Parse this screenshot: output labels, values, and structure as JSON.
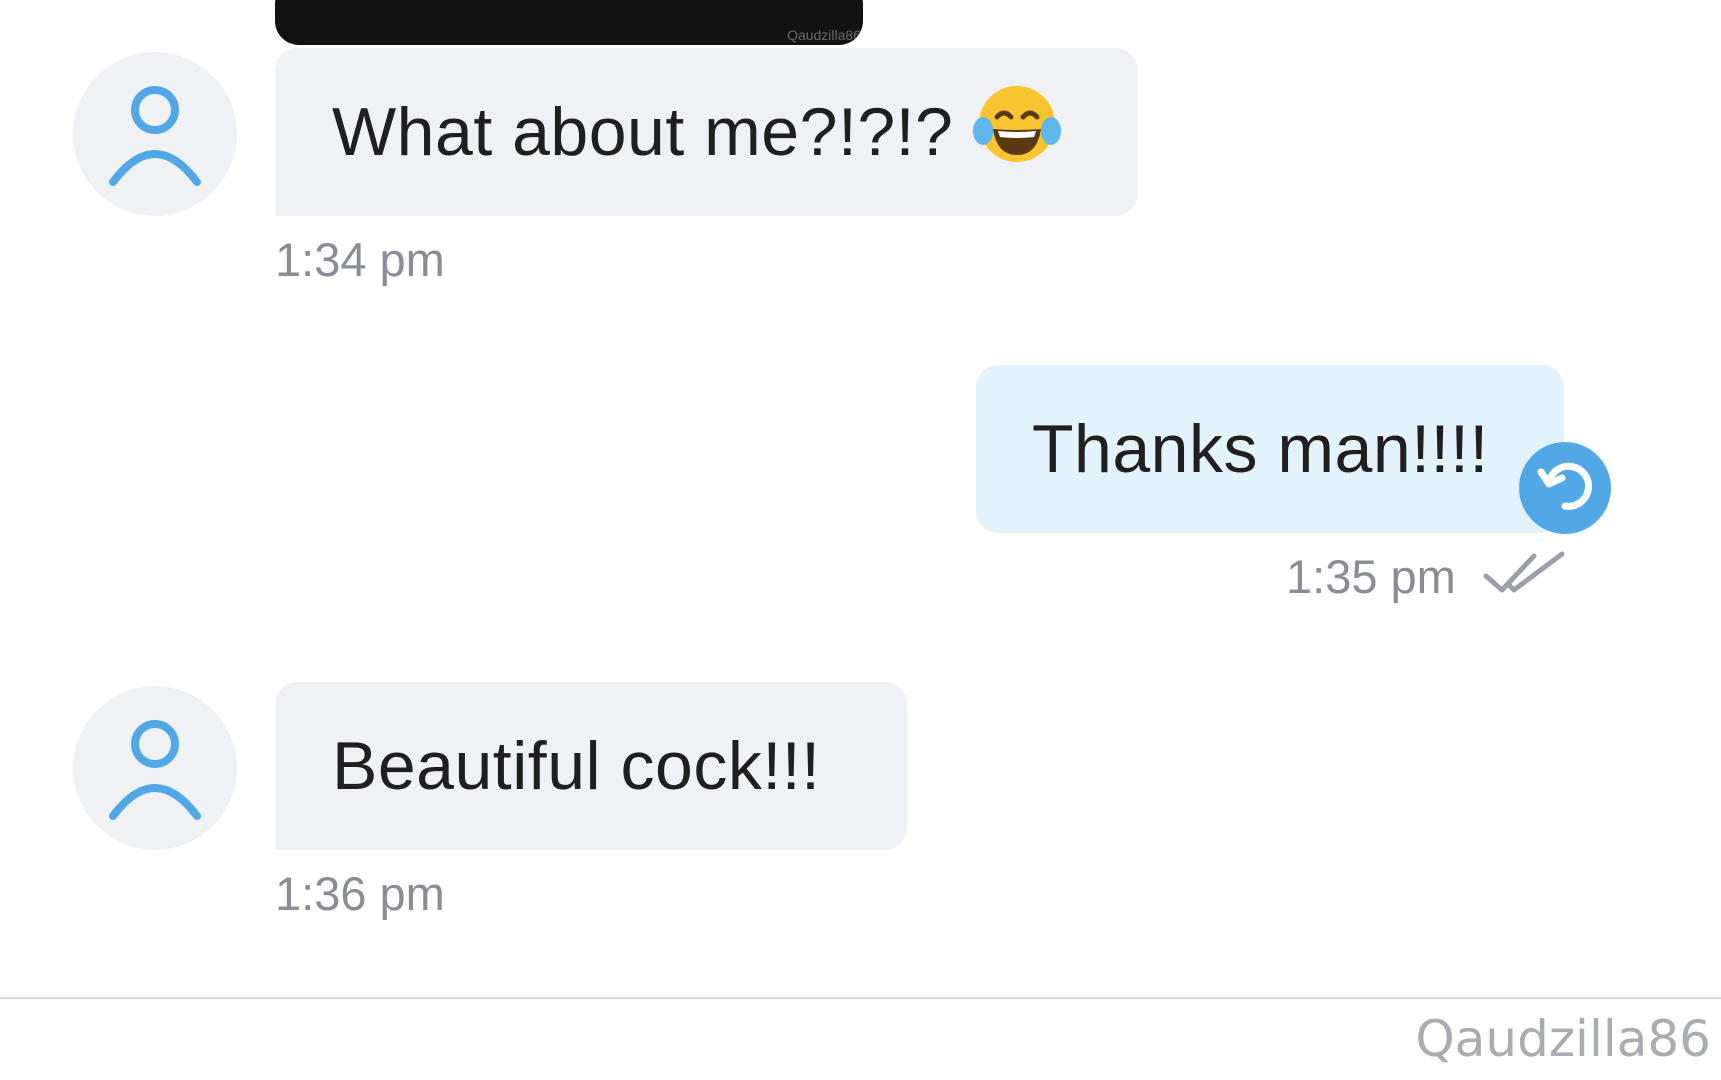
{
  "media": {
    "watermark": "Qaudzilla86"
  },
  "messages": [
    {
      "direction": "incoming",
      "text": "What about me?!?!?",
      "emoji": "😂",
      "time": "1:34 pm",
      "avatar_icon": "user-icon"
    },
    {
      "direction": "outgoing",
      "text": "Thanks man!!!!",
      "time": "1:35 pm",
      "status_icon": "double-check-icon",
      "action_icon": "reply-icon"
    },
    {
      "direction": "incoming",
      "text": "Beautiful cock!!!",
      "time": "1:36 pm",
      "avatar_icon": "user-icon"
    }
  ],
  "footer": {
    "watermark": "Qaudzilla86"
  },
  "colors": {
    "incoming_bubble": "#eff1f4",
    "outgoing_bubble": "#e3f3fc",
    "accent": "#52a8e6",
    "timestamp": "#8a8e94"
  }
}
